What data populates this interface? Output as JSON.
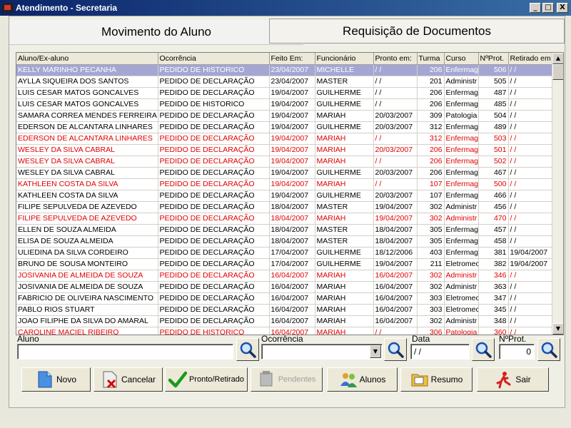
{
  "window": {
    "title": "Atendimento - Secretaria",
    "minimize": "_",
    "maximize": "□",
    "close": "X"
  },
  "tabs": {
    "movimento": "Movimento do Aluno",
    "requisicao": "Requisição de Documentos"
  },
  "table": {
    "headers": [
      "Aluno/Ex-aluno",
      "Ocorrência",
      "Feito Em:",
      "Funcionário",
      "Pronto em:",
      "Turma",
      "Curso",
      "NºProt.",
      "Retirado em"
    ],
    "rows": [
      {
        "style": "sel",
        "cells": [
          "KELLY MARINHO PECANHA",
          "PEDIDO DE HISTORICO",
          "23/04/2007",
          "MICHELLE",
          "/ /",
          "206",
          "Enfermag",
          "506",
          "/ /"
        ]
      },
      {
        "style": "",
        "cells": [
          "AYLLA SIQUEIRA DOS SANTOS",
          "PEDIDO DE DECLARAÇÃO",
          "23/04/2007",
          "MASTER",
          "/ /",
          "201",
          "Administr",
          "505",
          "/ /"
        ]
      },
      {
        "style": "",
        "cells": [
          "LUIS CESAR MATOS GONCALVES",
          "PEDIDO DE DECLARAÇÃO",
          "19/04/2007",
          "GUILHERME",
          "/ /",
          "206",
          "Enfermag",
          "487",
          "/ /"
        ]
      },
      {
        "style": "",
        "cells": [
          "LUIS CESAR MATOS GONCALVES",
          "PEDIDO DE HISTORICO",
          "19/04/2007",
          "GUILHERME",
          "/ /",
          "206",
          "Enfermag",
          "485",
          "/ /"
        ]
      },
      {
        "style": "",
        "cells": [
          "SAMARA CORREA MENDES FERREIRA",
          "PEDIDO DE DECLARAÇÃO",
          "19/04/2007",
          "MARIAH",
          "20/03/2007",
          "309",
          "Patologia",
          "504",
          "/ /"
        ]
      },
      {
        "style": "",
        "cells": [
          "EDERSON DE ALCANTARA LINHARES",
          "PEDIDO DE DECLARAÇÃO",
          "19/04/2007",
          "GUILHERME",
          "20/03/2007",
          "312",
          "Enfermag",
          "489",
          "/ /"
        ]
      },
      {
        "style": "red",
        "cells": [
          "EDERSON DE ALCANTARA LINHARES",
          "PEDIDO DE DECLARAÇÃO",
          "19/04/2007",
          "MARIAH",
          "/ /",
          "312",
          "Enfermag",
          "503",
          "/ /"
        ]
      },
      {
        "style": "red",
        "cells": [
          "WESLEY DA SILVA CABRAL",
          "PEDIDO DE DECLARAÇÃO",
          "19/04/2007",
          "MARIAH",
          "20/03/2007",
          "206",
          "Enfermag",
          "501",
          "/ /"
        ]
      },
      {
        "style": "red",
        "cells": [
          "WESLEY DA SILVA CABRAL",
          "PEDIDO DE DECLARAÇÃO",
          "19/04/2007",
          "MARIAH",
          "/ /",
          "206",
          "Enfermag",
          "502",
          "/ /"
        ]
      },
      {
        "style": "",
        "cells": [
          "WESLEY DA SILVA CABRAL",
          "PEDIDO DE DECLARAÇÃO",
          "19/04/2007",
          "GUILHERME",
          "20/03/2007",
          "206",
          "Enfermag",
          "467",
          "/ /"
        ]
      },
      {
        "style": "red",
        "cells": [
          "KATHLEEN COSTA DA SILVA",
          "PEDIDO DE DECLARAÇÃO",
          "19/04/2007",
          "MARIAH",
          "/ /",
          "107",
          "Enfermag",
          "500",
          "/ /"
        ]
      },
      {
        "style": "",
        "cells": [
          "KATHLEEN COSTA DA SILVA",
          "PEDIDO DE DECLARAÇÃO",
          "19/04/2007",
          "GUILHERME",
          "20/03/2007",
          "107",
          "Enfermag",
          "466",
          "/ /"
        ]
      },
      {
        "style": "",
        "cells": [
          "FILIPE SEPULVEDA DE AZEVEDO",
          "PEDIDO DE DECLARAÇÃO",
          "18/04/2007",
          "MASTER",
          "19/04/2007",
          "302",
          "Administr",
          "456",
          "/ /"
        ]
      },
      {
        "style": "red",
        "cells": [
          "FILIPE SEPULVEDA DE AZEVEDO",
          "PEDIDO DE DECLARAÇÃO",
          "18/04/2007",
          "MARIAH",
          "19/04/2007",
          "302",
          "Administr",
          "470",
          "/ /"
        ]
      },
      {
        "style": "",
        "cells": [
          "ELLEN DE SOUZA ALMEIDA",
          "PEDIDO DE DECLARAÇÃO",
          "18/04/2007",
          "MASTER",
          "18/04/2007",
          "305",
          "Enfermag",
          "457",
          "/ /"
        ]
      },
      {
        "style": "",
        "cells": [
          "ELISA DE SOUZA ALMEIDA",
          "PEDIDO DE DECLARAÇÃO",
          "18/04/2007",
          "MASTER",
          "18/04/2007",
          "305",
          "Enfermag",
          "458",
          "/ /"
        ]
      },
      {
        "style": "",
        "cells": [
          "ULIEDINA DA SILVA CORDEIRO",
          "PEDIDO DE DECLARAÇÃO",
          "17/04/2007",
          "GUILHERME",
          "18/12/2006",
          "403",
          "Enfermag",
          "381",
          "19/04/2007"
        ]
      },
      {
        "style": "",
        "cells": [
          "BRUNO DE SOUSA MONTEIRO",
          "PEDIDO DE DECLARAÇÃO",
          "17/04/2007",
          "GUILHERME",
          "19/04/2007",
          "211",
          "Eletromec",
          "382",
          "19/04/2007"
        ]
      },
      {
        "style": "red",
        "cells": [
          "JOSIVANIA DE ALMEIDA DE SOUZA",
          "PEDIDO DE DECLARAÇÃO",
          "16/04/2007",
          "MARIAH",
          "16/04/2007",
          "302",
          "Administr",
          "346",
          "/ /"
        ]
      },
      {
        "style": "",
        "cells": [
          "JOSIVANIA DE ALMEIDA DE SOUZA",
          "PEDIDO DE DECLARAÇÃO",
          "16/04/2007",
          "MARIAH",
          "16/04/2007",
          "302",
          "Administr",
          "363",
          "/ /"
        ]
      },
      {
        "style": "",
        "cells": [
          "FABRICIO DE OLIVEIRA NASCIMENTO",
          "PEDIDO DE DECLARAÇÃO",
          "16/04/2007",
          "MARIAH",
          "16/04/2007",
          "303",
          "Eletromec",
          "347",
          "/ /"
        ]
      },
      {
        "style": "",
        "cells": [
          "PABLO RIOS STUART",
          "PEDIDO DE DECLARAÇÃO",
          "16/04/2007",
          "MARIAH",
          "16/04/2007",
          "303",
          "Eletromec",
          "345",
          "/ /"
        ]
      },
      {
        "style": "",
        "cells": [
          "JOAO FILIPHE DA SILVA DO AMARAL",
          "PEDIDO DE DECLARAÇÃO",
          "16/04/2007",
          "MARIAH",
          "16/04/2007",
          "302",
          "Administr",
          "348",
          "/ /"
        ]
      },
      {
        "style": "red",
        "cells": [
          "CAROLINE MACIEL RIBEIRO",
          "PEDIDO DE HISTORICO",
          "16/04/2007",
          "MARIAH",
          "/ /",
          "306",
          "Patologia",
          "360",
          "/ /"
        ]
      }
    ]
  },
  "filters": {
    "aluno_label": "Aluno",
    "aluno_value": "",
    "ocorrencia_label": "Ocorrência",
    "ocorrencia_value": "",
    "data_label": "Data",
    "data_value": "/ /",
    "nprot_label": "NºProt.",
    "nprot_value": "0"
  },
  "actions": {
    "novo": "Novo",
    "cancelar": "Cancelar",
    "pronto": "Pronto/Retirado",
    "pendentes": "Pendentes",
    "alunos": "Alunos",
    "resumo": "Resumo",
    "sair": "Sair"
  },
  "colors": {
    "title_start": "#0a246a",
    "selected_row": "#a4a6d4",
    "alert_row_text": "#e00000"
  }
}
